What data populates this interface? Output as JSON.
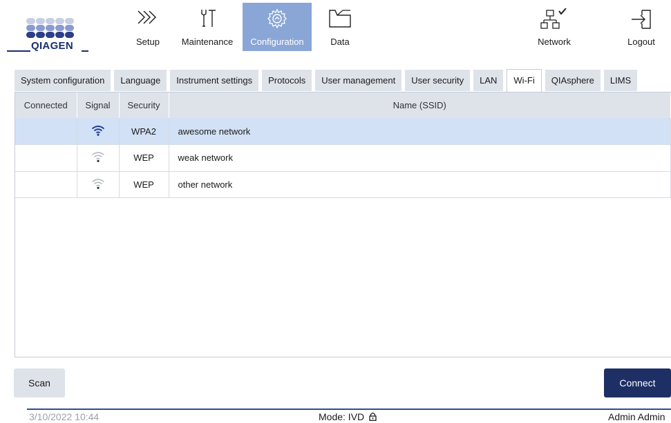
{
  "brand": {
    "name": "QIAGEN",
    "color": "#1a2f6b"
  },
  "nav": {
    "setup": "Setup",
    "maintenance": "Maintenance",
    "configuration": "Configuration",
    "data": "Data",
    "network": "Network",
    "logout": "Logout"
  },
  "tabs": [
    "System configuration",
    "Language",
    "Instrument settings",
    "Protocols",
    "User management",
    "User security",
    "LAN",
    "Wi-Fi",
    "QIAsphere",
    "LIMS"
  ],
  "active_tab": "Wi-Fi",
  "wifi_table": {
    "headers": {
      "connected": "Connected",
      "signal": "Signal",
      "security": "Security",
      "name": "Name (SSID)"
    },
    "rows": [
      {
        "connected": "",
        "signal": "strong",
        "security": "WPA2",
        "name": "awesome network",
        "selected": true
      },
      {
        "connected": "",
        "signal": "weak",
        "security": "WEP",
        "name": "weak network",
        "selected": false
      },
      {
        "connected": "",
        "signal": "weak",
        "security": "WEP",
        "name": "other network",
        "selected": false
      }
    ]
  },
  "actions": {
    "scan": "Scan",
    "connect": "Connect"
  },
  "footer": {
    "datetime": "3/10/2022 10:44",
    "mode": "Mode: IVD",
    "user": "Admin Admin"
  },
  "colors": {
    "accent": "#8aa6d6",
    "primary": "#1e2f66",
    "selected_row": "#d3e1f6",
    "tab_bg": "#dee3ea"
  }
}
